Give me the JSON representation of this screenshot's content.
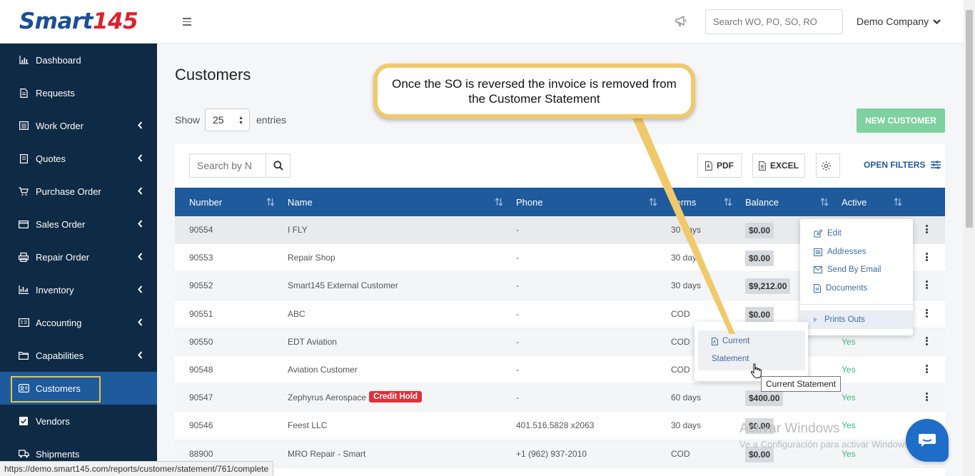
{
  "brand": {
    "logo_word": "Smart",
    "logo_num": "145"
  },
  "topbar": {
    "search_placeholder": "Search WO, PO, SO, RO",
    "company": "Demo Company"
  },
  "sidebar": {
    "items": [
      {
        "label": "Dashboard",
        "icon": "chart-icon",
        "chevron": false
      },
      {
        "label": "Requests",
        "icon": "document-icon",
        "chevron": false
      },
      {
        "label": "Work Order",
        "icon": "list-icon",
        "chevron": true
      },
      {
        "label": "Quotes",
        "icon": "quote-icon",
        "chevron": true
      },
      {
        "label": "Purchase Order",
        "icon": "cart-icon",
        "chevron": true
      },
      {
        "label": "Sales Order",
        "icon": "card-icon",
        "chevron": true
      },
      {
        "label": "Repair Order",
        "icon": "printer-icon",
        "chevron": true
      },
      {
        "label": "Inventory",
        "icon": "inventory-icon",
        "chevron": true
      },
      {
        "label": "Accounting",
        "icon": "accounting-icon",
        "chevron": true
      },
      {
        "label": "Capabilities",
        "icon": "folder-icon",
        "chevron": true
      },
      {
        "label": "Customers",
        "icon": "customers-icon",
        "chevron": false,
        "active": true
      },
      {
        "label": "Vendors",
        "icon": "check-icon",
        "chevron": false
      },
      {
        "label": "Shipments",
        "icon": "truck-icon",
        "chevron": false
      }
    ]
  },
  "main": {
    "title": "Customers",
    "show_label": "Show",
    "entries_value": "25",
    "entries_label": "entries",
    "new_customer": "NEW CUSTOMER",
    "search_placeholder": "Search by N",
    "pdf": "PDF",
    "excel": "EXCEL",
    "open_filters": "OPEN FILTERS"
  },
  "table": {
    "columns": [
      "Number",
      "Name",
      "Phone",
      "Terms",
      "Balance",
      "Active"
    ],
    "rows": [
      {
        "number": "90554",
        "name": "I FLY",
        "phone": "-",
        "terms": "30 days",
        "balance": "$0.00",
        "active": ""
      },
      {
        "number": "90553",
        "name": "Repair Shop",
        "phone": "-",
        "terms": "30 days",
        "balance": "$0.00",
        "active": ""
      },
      {
        "number": "90552",
        "name": "Smart145 External Customer",
        "phone": "-",
        "terms": "30 days",
        "balance": "$9,212.00",
        "active": ""
      },
      {
        "number": "90551",
        "name": "ABC",
        "phone": "-",
        "terms": "COD",
        "balance": "$0.00",
        "active": ""
      },
      {
        "number": "90550",
        "name": "EDT Aviation",
        "phone": "-",
        "terms": "COD",
        "balance": "",
        "active": "Yes"
      },
      {
        "number": "90548",
        "name": "Aviation Customer",
        "phone": "-",
        "terms": "COD",
        "balance": "",
        "active": "Yes"
      },
      {
        "number": "90547",
        "name": "Zephyrus Aerospace",
        "badge": "Credit Hold",
        "phone": "-",
        "terms": "60 days",
        "balance": "$400.00",
        "active": "Yes"
      },
      {
        "number": "90546",
        "name": "Feest LLC",
        "phone": "401.516.5828 x2063",
        "terms": "30 days",
        "balance": "$0.00",
        "active": "Yes"
      },
      {
        "number": "88900",
        "name": "MRO Repair - Smart",
        "phone": "+1 (962) 937-2010",
        "terms": "COD",
        "balance": "$0.00",
        "active": "Yes"
      }
    ]
  },
  "actions_menu": {
    "items": [
      {
        "label": "Edit",
        "icon": "edit-icon"
      },
      {
        "label": "Addresses",
        "icon": "address-icon"
      },
      {
        "label": "Send By Email",
        "icon": "email-icon"
      },
      {
        "label": "Documents",
        "icon": "document-icon"
      }
    ],
    "prints_outs": "Prints Outs"
  },
  "submenu": {
    "line1": "Current",
    "line2": "Statement",
    "tooltip": "Current Statement"
  },
  "callout": {
    "text": "Once the SO is reversed the invoice is removed from the Customer Statement"
  },
  "watermark": {
    "line1": "Activar Windows",
    "line2": "Ve a Configuración para activar Windows."
  },
  "statusbar": {
    "url": "https://demo.smart145.com/reports/customer/statement/761/complete"
  },
  "colors": {
    "sidebar": "#0f2a44",
    "accent": "#1e5a9c",
    "success": "#7fd1a0",
    "danger": "#e0303a",
    "callout_border": "#f0c96a"
  }
}
